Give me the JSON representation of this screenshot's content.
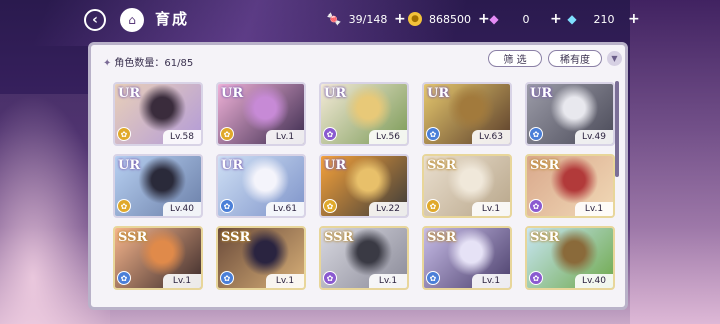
{
  "header": {
    "title": "育成",
    "back_icon": "back-arrow-icon",
    "home_icon": "castle-home-icon"
  },
  "resources": [
    {
      "name": "candy",
      "icon": "candy-icon",
      "value": "39/148"
    },
    {
      "name": "coin",
      "icon": "gold-coin-icon",
      "value": "868500"
    },
    {
      "name": "pink-gem",
      "icon": "pink-gem-icon",
      "value": "0"
    },
    {
      "name": "blue-gem",
      "icon": "blue-gem-icon",
      "value": "210"
    }
  ],
  "panel": {
    "count_label": "角色数量：61/85",
    "filter_label": "筛 选",
    "sort_label": "稀有度",
    "sort_dir_icon": "sort-down-icon"
  },
  "cards": [
    {
      "rarity": "UR",
      "level": "Lv.58",
      "element": "yellow",
      "art": [
        "#e9d0b8",
        "#3a2c3c",
        "#b29ad8"
      ]
    },
    {
      "rarity": "UR",
      "level": "Lv.1",
      "element": "yellow",
      "art": [
        "#f0b2d8",
        "#c78ad6",
        "#3b2b4e"
      ]
    },
    {
      "rarity": "UR",
      "level": "Lv.56",
      "element": "purple",
      "art": [
        "#f4ead8",
        "#e8c978",
        "#7a9a56"
      ]
    },
    {
      "rarity": "UR",
      "level": "Lv.63",
      "element": "blue",
      "art": [
        "#e6c86e",
        "#a27a3c",
        "#5a3d2a"
      ]
    },
    {
      "rarity": "UR",
      "level": "Lv.49",
      "element": "blue",
      "art": [
        "#9c9ca8",
        "#e8e8ee",
        "#4a4a58"
      ]
    },
    {
      "rarity": "UR",
      "level": "Lv.40",
      "element": "yellow",
      "art": [
        "#b7d0f2",
        "#2a2a3a",
        "#6b7fa8"
      ]
    },
    {
      "rarity": "UR",
      "level": "Lv.61",
      "element": "blue",
      "art": [
        "#cfe0f5",
        "#f4f4fb",
        "#7e93c9"
      ]
    },
    {
      "rarity": "UR",
      "level": "Lv.22",
      "element": "yellow",
      "art": [
        "#f6a23a",
        "#e8c06a",
        "#3a3a3a"
      ]
    },
    {
      "rarity": "SSR",
      "level": "Lv.1",
      "element": "yellow",
      "art": [
        "#eadfcf",
        "#f0e8da",
        "#b8a68a"
      ]
    },
    {
      "rarity": "SSR",
      "level": "Lv.1",
      "element": "purple",
      "art": [
        "#d9a88c",
        "#b23a3a",
        "#f1d9b6"
      ]
    },
    {
      "rarity": "SSR",
      "level": "Lv.1",
      "element": "blue",
      "art": [
        "#f6b58c",
        "#e08a4a",
        "#3a2a2a"
      ]
    },
    {
      "rarity": "SSR",
      "level": "Lv.1",
      "element": "blue",
      "art": [
        "#6a4a3a",
        "#2a2440",
        "#d8b078"
      ]
    },
    {
      "rarity": "SSR",
      "level": "Lv.1",
      "element": "purple",
      "art": [
        "#d8d8e0",
        "#3a3a44",
        "#8a8a98"
      ]
    },
    {
      "rarity": "SSR",
      "level": "Lv.1",
      "element": "blue",
      "art": [
        "#c8bde8",
        "#e6e2f6",
        "#4a3e6a"
      ]
    },
    {
      "rarity": "SSR",
      "level": "Lv.40",
      "element": "purple",
      "art": [
        "#c8e6f4",
        "#8a6a3a",
        "#6ea84a"
      ]
    }
  ],
  "colors": {
    "ur_glow": "#7a5fb0",
    "ssr_glow": "#b8892e",
    "element_yellow": "#e0a92a",
    "element_blue": "#4a7fd8",
    "element_purple": "#8a5ad0"
  }
}
